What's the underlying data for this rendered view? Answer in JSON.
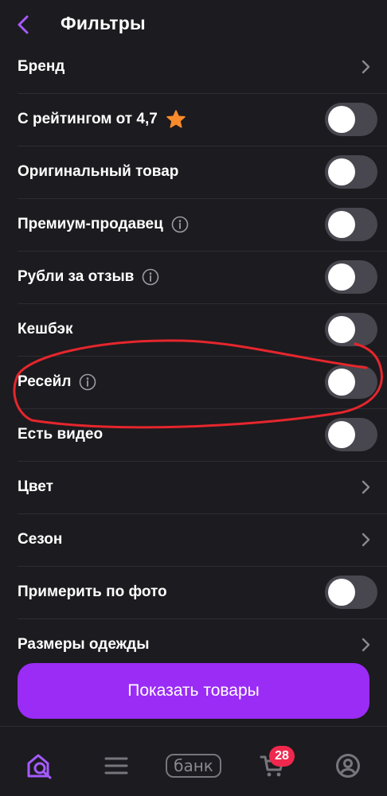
{
  "header": {
    "title": "Фильтры",
    "back_icon": "chevron-left-icon"
  },
  "colors": {
    "accent": "#9a2cf6",
    "background": "#1c1b1f",
    "toggle_off": "#48474f",
    "badge": "#f0284d",
    "star": "#f98b2a",
    "annotation": "#e5262d"
  },
  "filters": [
    {
      "label": "Бренд",
      "control": "chevron"
    },
    {
      "label": "С рейтингом от 4,7",
      "control": "toggle",
      "on": false,
      "icon": "star-icon"
    },
    {
      "label": "Оригинальный товар",
      "control": "toggle",
      "on": false
    },
    {
      "label": "Премиум-продавец",
      "control": "toggle",
      "on": false,
      "icon": "info-icon"
    },
    {
      "label": "Рубли за отзыв",
      "control": "toggle",
      "on": false,
      "icon": "info-icon"
    },
    {
      "label": "Кешбэк",
      "control": "toggle",
      "on": false
    },
    {
      "label": "Ресейл",
      "control": "toggle",
      "on": false,
      "icon": "info-icon"
    },
    {
      "label": "Есть видео",
      "control": "toggle",
      "on": false
    },
    {
      "label": "Цвет",
      "control": "chevron"
    },
    {
      "label": "Сезон",
      "control": "chevron"
    },
    {
      "label": "Примерить по фото",
      "control": "toggle",
      "on": false
    },
    {
      "label": "Размеры одежды",
      "control": "chevron"
    }
  ],
  "actions": {
    "show_button": "Показать товары"
  },
  "tabbar": {
    "items": [
      {
        "name": "home",
        "icon": "home-search-icon"
      },
      {
        "name": "catalog",
        "icon": "menu-icon"
      },
      {
        "name": "bank",
        "label": "банк"
      },
      {
        "name": "cart",
        "icon": "cart-icon",
        "badge": "28"
      },
      {
        "name": "profile",
        "icon": "profile-icon"
      }
    ]
  }
}
